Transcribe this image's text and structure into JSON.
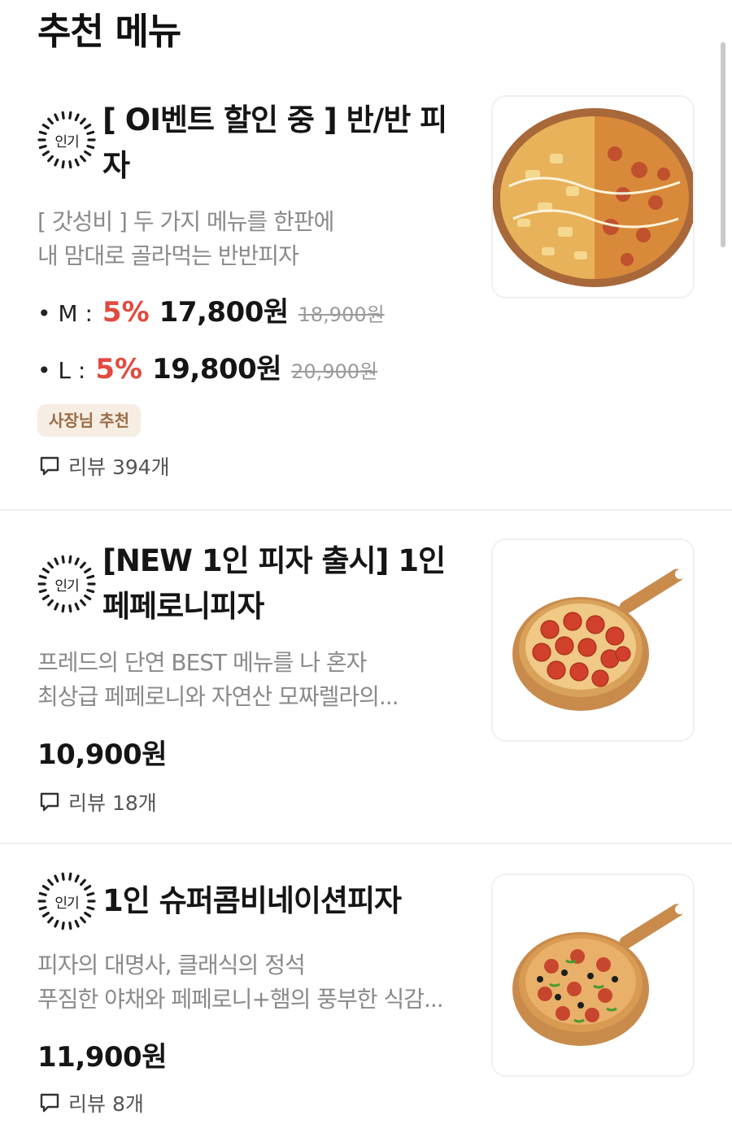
{
  "section": {
    "title": "추천 메뉴"
  },
  "badge_label": "인기",
  "review_label": "리뷰",
  "items": [
    {
      "name": "[ OI벤트 할인 중 ] 반/반 피자",
      "description": [
        "[ 갓성비 ] 두 가지 메뉴를 한판에",
        "내 맘대로 골라먹는 반반피자"
      ],
      "prices": [
        {
          "size": "• M :",
          "discount": "5%",
          "price": "17,800원",
          "original": "18,900원"
        },
        {
          "size": "• L :",
          "discount": "5%",
          "price": "19,800원",
          "original": "20,900원"
        }
      ],
      "tag": "사장님 추천",
      "review_count": "394개"
    },
    {
      "name": "[NEW 1인 피자 출시] 1인 페페로니피자",
      "description": [
        "프레드의 단연 BEST 메뉴를 나 혼자",
        "최상급 페페로니와 자연산 모짜렐라의..."
      ],
      "price": "10,900원",
      "review_count": "18개"
    },
    {
      "name": "1인 슈퍼콤비네이션피자",
      "description": [
        "피자의 대명사, 클래식의 정석",
        "푸짐한 야채와 페페로니+햄의 풍부한 식감..."
      ],
      "price": "11,900원",
      "review_count": "8개"
    }
  ],
  "colors": {
    "discount": "#e34a3f",
    "tag_bg": "#f6ede3",
    "tag_text": "#9a6c46",
    "muted": "#8a8a8a"
  }
}
